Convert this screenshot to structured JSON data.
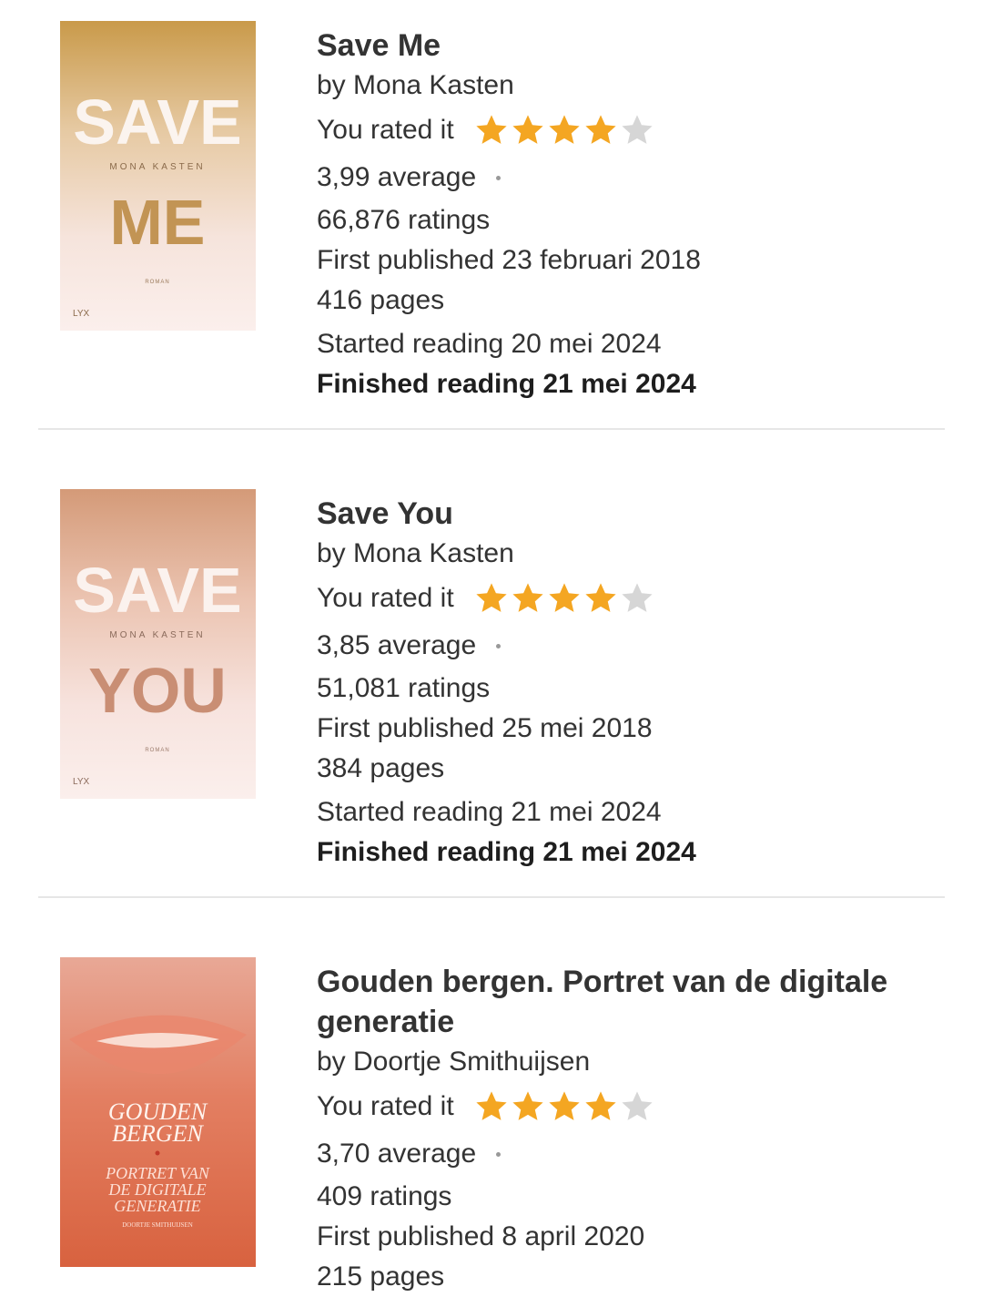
{
  "books": [
    {
      "title": "Save Me",
      "author": "by Mona Kasten",
      "rated_label": "You rated it",
      "user_rating": 4,
      "max_rating": 5,
      "average": "3,99 average",
      "ratings": "66,876 ratings",
      "first_published": "First published 23 februari 2018",
      "pages": "416 pages",
      "started": "Started reading 20 mei 2024",
      "finished": "Finished reading 21 mei 2024",
      "cover": {
        "line1": "SAVE",
        "author": "MONA KASTEN",
        "line2": "ME",
        "genre": "ROMAN",
        "publisher": "LYX"
      }
    },
    {
      "title": "Save You",
      "author": "by Mona Kasten",
      "rated_label": "You rated it",
      "user_rating": 4,
      "max_rating": 5,
      "average": "3,85 average",
      "ratings": "51,081 ratings",
      "first_published": "First published 25 mei 2018",
      "pages": "384 pages",
      "started": "Started reading 21 mei 2024",
      "finished": "Finished reading 21 mei 2024",
      "cover": {
        "line1": "SAVE",
        "author": "MONA KASTEN",
        "line2": "YOU",
        "genre": "ROMAN",
        "publisher": "LYX"
      }
    },
    {
      "title": "Gouden bergen. Portret van de digitale generatie",
      "author": "by Doortje Smithuijsen",
      "rated_label": "You rated it",
      "user_rating": 4,
      "max_rating": 5,
      "average": "3,70 average",
      "ratings": "409 ratings",
      "first_published": "First published 8 april 2020",
      "pages": "215 pages",
      "cover": {
        "line1": "GOUDEN",
        "line2": "BERGEN",
        "sub1": "PORTRET VAN",
        "sub2": "DE DIGITALE",
        "sub3": "GENERATIE",
        "author": "DOORTJE SMITHUIJSEN"
      }
    }
  ],
  "colors": {
    "star_filled": "#F4A622",
    "star_empty": "#D6D6D6",
    "divider": "#E6E6E6"
  }
}
